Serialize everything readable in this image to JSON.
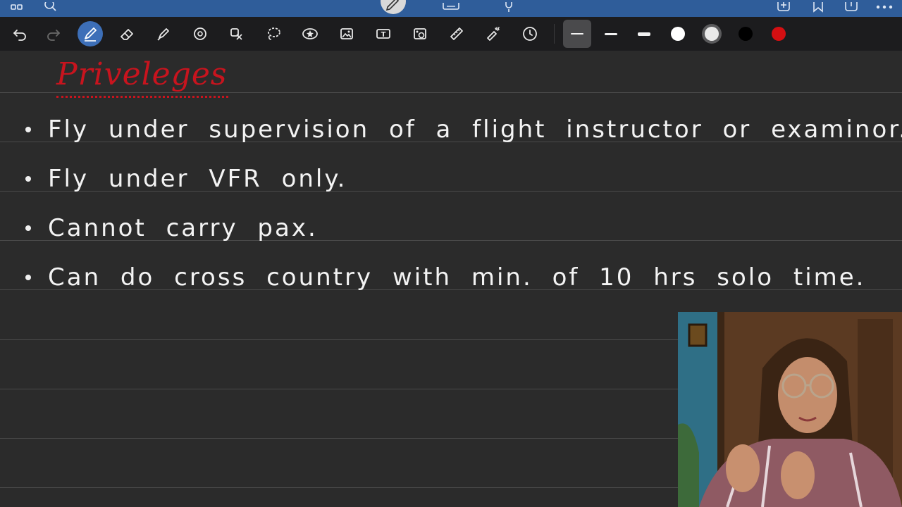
{
  "app": {
    "top_icons": [
      "grid-icon",
      "search-icon",
      "pen-mode-icon",
      "keyboard-icon",
      "microphone-icon",
      "add-page-icon",
      "bookmark-icon",
      "share-icon",
      "more-icon"
    ]
  },
  "toolbar": {
    "tools": [
      {
        "name": "undo-icon"
      },
      {
        "name": "redo-icon"
      },
      {
        "name": "pen-icon",
        "active": true
      },
      {
        "name": "eraser-icon"
      },
      {
        "name": "highlighter-icon"
      },
      {
        "name": "shape-icon"
      },
      {
        "name": "sticker-icon"
      },
      {
        "name": "lasso-icon"
      },
      {
        "name": "star-icon"
      },
      {
        "name": "image-icon"
      },
      {
        "name": "text-icon",
        "label": "T"
      },
      {
        "name": "camera-icon"
      },
      {
        "name": "ruler-icon"
      },
      {
        "name": "laser-icon"
      },
      {
        "name": "clock-icon"
      }
    ],
    "stroke_sizes": [
      "thin",
      "medium",
      "thick"
    ],
    "colors": {
      "white": "#ffffff",
      "light_grey": "#e9e9e9",
      "black": "#000000",
      "red": "#d40f12"
    }
  },
  "note": {
    "heading": "Priveleges",
    "heading_color": "#c8141e",
    "bullets": [
      "Fly under supervision of a flight instructor or examinor.",
      "Fly under VFR only.",
      "Cannot carry pax.",
      "Can do cross country with min. of 10 hrs solo time."
    ]
  }
}
